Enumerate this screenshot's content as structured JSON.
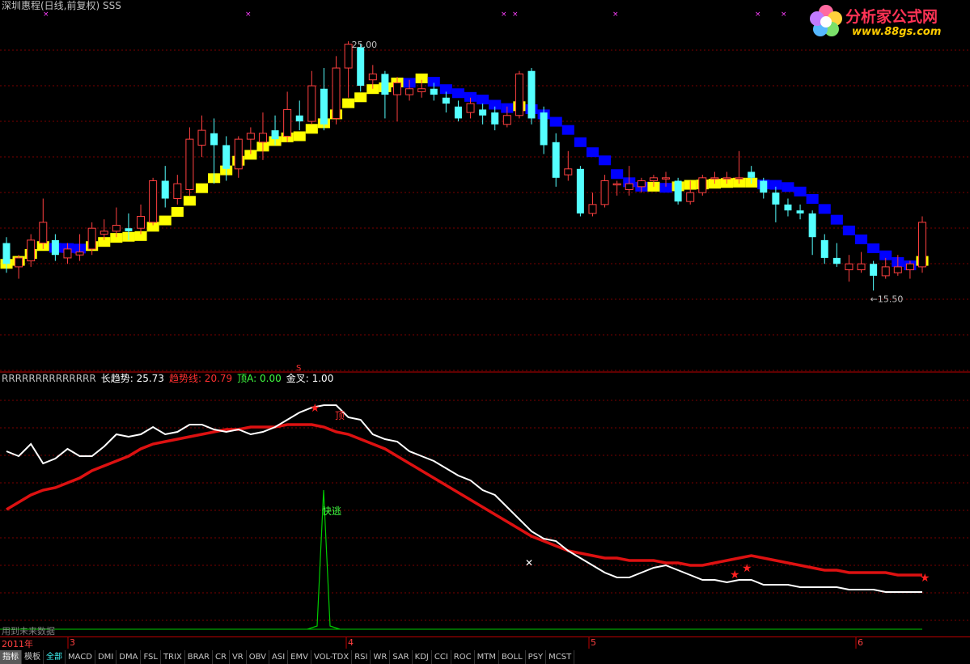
{
  "header": {
    "title": "深圳惠程(日线,前复权) SSS"
  },
  "watermark": {
    "site_name": "分析家公式网",
    "url": "www.88gs.com"
  },
  "price_chart": {
    "high_label": "25.00",
    "low_label": "←15.50",
    "signal_marker": "S",
    "price_range": [
      14.5,
      26.0
    ],
    "candles": [
      [
        18.3,
        17.6,
        18.5,
        17.3
      ],
      [
        17.5,
        17.8,
        17.9,
        17.1
      ],
      [
        17.7,
        18.4,
        18.6,
        17.5
      ],
      [
        18.3,
        19.0,
        19.8,
        18.1
      ],
      [
        18.4,
        17.9,
        18.6,
        17.7
      ],
      [
        17.8,
        18.1,
        18.3,
        17.6
      ],
      [
        17.9,
        18.0,
        18.6,
        17.7
      ],
      [
        18.1,
        18.8,
        19.0,
        17.9
      ],
      [
        18.6,
        18.7,
        19.1,
        18.4
      ],
      [
        18.7,
        18.9,
        19.5,
        18.5
      ],
      [
        18.8,
        18.7,
        19.3,
        18.4
      ],
      [
        18.8,
        19.2,
        19.6,
        18.6
      ],
      [
        19.0,
        20.4,
        20.5,
        18.9
      ],
      [
        20.4,
        19.8,
        20.9,
        19.5
      ],
      [
        19.8,
        20.3,
        20.6,
        19.6
      ],
      [
        20.1,
        21.8,
        22.2,
        19.9
      ],
      [
        21.6,
        22.1,
        22.6,
        21.2
      ],
      [
        22.0,
        21.6,
        22.5,
        20.3
      ],
      [
        21.6,
        20.8,
        21.9,
        20.4
      ],
      [
        20.8,
        21.8,
        21.9,
        20.5
      ],
      [
        21.8,
        22.0,
        22.2,
        21.3
      ],
      [
        21.7,
        22.0,
        22.7,
        21.1
      ],
      [
        22.1,
        21.8,
        22.6,
        21.6
      ],
      [
        21.9,
        22.8,
        23.4,
        21.7
      ],
      [
        22.6,
        22.4,
        23.1,
        22.1
      ],
      [
        22.4,
        23.6,
        24.1,
        22.3
      ],
      [
        23.5,
        22.3,
        24.2,
        22.1
      ],
      [
        22.5,
        24.2,
        24.6,
        22.3
      ],
      [
        24.2,
        25.0,
        25.1,
        23.2
      ],
      [
        24.9,
        23.6,
        25.0,
        23.4
      ],
      [
        23.8,
        24.0,
        24.3,
        23.5
      ],
      [
        24.0,
        23.3,
        24.1,
        22.5
      ],
      [
        23.3,
        23.7,
        23.9,
        22.4
      ],
      [
        23.3,
        23.5,
        23.8,
        23.1
      ],
      [
        23.4,
        23.5,
        23.8,
        23.2
      ],
      [
        23.5,
        23.3,
        23.7,
        23.1
      ],
      [
        23.2,
        23.0,
        23.4,
        22.7
      ],
      [
        22.9,
        22.5,
        23.1,
        22.4
      ],
      [
        22.7,
        23.0,
        23.2,
        22.5
      ],
      [
        22.8,
        22.6,
        23.0,
        22.3
      ],
      [
        22.7,
        22.3,
        22.9,
        22.1
      ],
      [
        22.3,
        22.6,
        22.9,
        22.2
      ],
      [
        22.6,
        24.0,
        24.1,
        22.5
      ],
      [
        24.1,
        22.5,
        24.2,
        22.3
      ],
      [
        22.7,
        21.6,
        22.9,
        21.3
      ],
      [
        21.7,
        20.5,
        22.0,
        20.2
      ],
      [
        20.6,
        20.8,
        21.4,
        20.4
      ],
      [
        20.8,
        19.3,
        20.9,
        19.2
      ],
      [
        19.3,
        19.6,
        20.0,
        19.2
      ],
      [
        19.6,
        20.4,
        20.6,
        19.5
      ],
      [
        20.3,
        20.3,
        20.4,
        19.9
      ],
      [
        20.1,
        20.3,
        20.9,
        19.9
      ],
      [
        20.2,
        20.4,
        20.5,
        20.0
      ],
      [
        20.4,
        20.5,
        20.6,
        20.2
      ],
      [
        20.5,
        20.5,
        20.7,
        20.2
      ],
      [
        20.4,
        19.7,
        20.5,
        19.6
      ],
      [
        19.7,
        20.0,
        20.4,
        19.6
      ],
      [
        20.0,
        20.5,
        20.6,
        19.9
      ],
      [
        20.5,
        20.5,
        20.7,
        20.3
      ],
      [
        20.5,
        20.5,
        20.7,
        20.3
      ],
      [
        20.5,
        20.5,
        21.4,
        20.3
      ],
      [
        20.7,
        20.5,
        20.9,
        20.3
      ],
      [
        20.4,
        20.0,
        20.5,
        19.8
      ],
      [
        20.0,
        19.6,
        20.2,
        19.0
      ],
      [
        19.6,
        19.4,
        19.8,
        19.2
      ],
      [
        19.4,
        19.3,
        19.6,
        19.1
      ],
      [
        19.3,
        18.5,
        19.4,
        17.9
      ],
      [
        18.4,
        17.8,
        18.6,
        17.6
      ],
      [
        17.8,
        17.6,
        18.3,
        17.5
      ],
      [
        17.4,
        17.6,
        17.9,
        17.0
      ],
      [
        17.4,
        17.6,
        18.0,
        17.3
      ],
      [
        17.6,
        17.2,
        17.7,
        16.7
      ],
      [
        17.2,
        17.5,
        17.8,
        17.1
      ],
      [
        17.3,
        17.5,
        17.9,
        17.2
      ],
      [
        17.4,
        17.6,
        17.7,
        17.1
      ],
      [
        17.5,
        19.0,
        19.2,
        17.3
      ]
    ]
  },
  "indicator": {
    "prefix": "RRRRRRRRRRRRRR",
    "long_trend_label": "长趋势: 25.73",
    "trend_line_label": "趋势线: 20.79",
    "top_a_label": "顶A: 0.00",
    "golden_cross_label": "金叉: 1.00",
    "annotation_top": "顶",
    "annotation_fast_escape": "快逃",
    "annotation_bottom_left": "用到未来数据",
    "white_line": [
      54,
      52,
      57,
      49,
      51,
      55,
      52,
      52,
      56,
      61,
      60,
      61,
      64,
      61,
      62,
      65,
      65,
      63,
      62,
      63,
      61,
      62,
      64,
      67,
      70,
      72,
      73,
      73,
      68,
      67,
      61,
      59,
      58,
      54,
      52,
      50,
      47,
      44,
      42,
      38,
      36,
      31,
      26,
      21,
      18,
      17,
      13,
      10,
      7,
      4,
      2,
      2,
      4,
      6,
      7,
      5,
      3,
      1,
      1,
      0,
      1,
      1,
      -1,
      -1,
      -1,
      -2,
      -2,
      -2,
      -2,
      -3,
      -3,
      -3,
      -4,
      -4,
      -4,
      -4
    ],
    "red_line": [
      30,
      33,
      36,
      38,
      39,
      41,
      43,
      46,
      48,
      50,
      52,
      55,
      57,
      58,
      59,
      60,
      61,
      62,
      63,
      63,
      64,
      64,
      64,
      65,
      65,
      65,
      64,
      62,
      61,
      59,
      57,
      55,
      52,
      49,
      46,
      43,
      40,
      37,
      34,
      31,
      28,
      25,
      22,
      19,
      17,
      15,
      13,
      12,
      11,
      10,
      10,
      9,
      9,
      9,
      8,
      8,
      7,
      7,
      8,
      9,
      10,
      11,
      10,
      9,
      8,
      7,
      6,
      5,
      5,
      4,
      4,
      4,
      4,
      3,
      3,
      3
    ],
    "spike_level": 60
  },
  "date_axis": {
    "ticks": [
      {
        "label": "2011年"
      },
      {
        "label": "3"
      },
      {
        "label": "4"
      },
      {
        "label": "5"
      },
      {
        "label": "6"
      }
    ]
  },
  "tabbar": {
    "tabs": [
      "指标",
      "模板",
      "全部",
      "MACD",
      "DMI",
      "DMA",
      "FSL",
      "TRIX",
      "BRAR",
      "CR",
      "VR",
      "OBV",
      "ASI",
      "EMV",
      "VOL-TDX",
      "RSI",
      "WR",
      "SAR",
      "KDJ",
      "CCI",
      "ROC",
      "MTM",
      "BOLL",
      "PSY",
      "MCST"
    ]
  },
  "colors": {
    "up_candle": "#ff4040",
    "down_candle": "#54ffff",
    "trend_up": "#ffff00",
    "trend_down": "#0000ff",
    "grid": "#7a0000",
    "white_line": "#ffffff",
    "red_line": "#d11",
    "spike": "#00cc00"
  }
}
